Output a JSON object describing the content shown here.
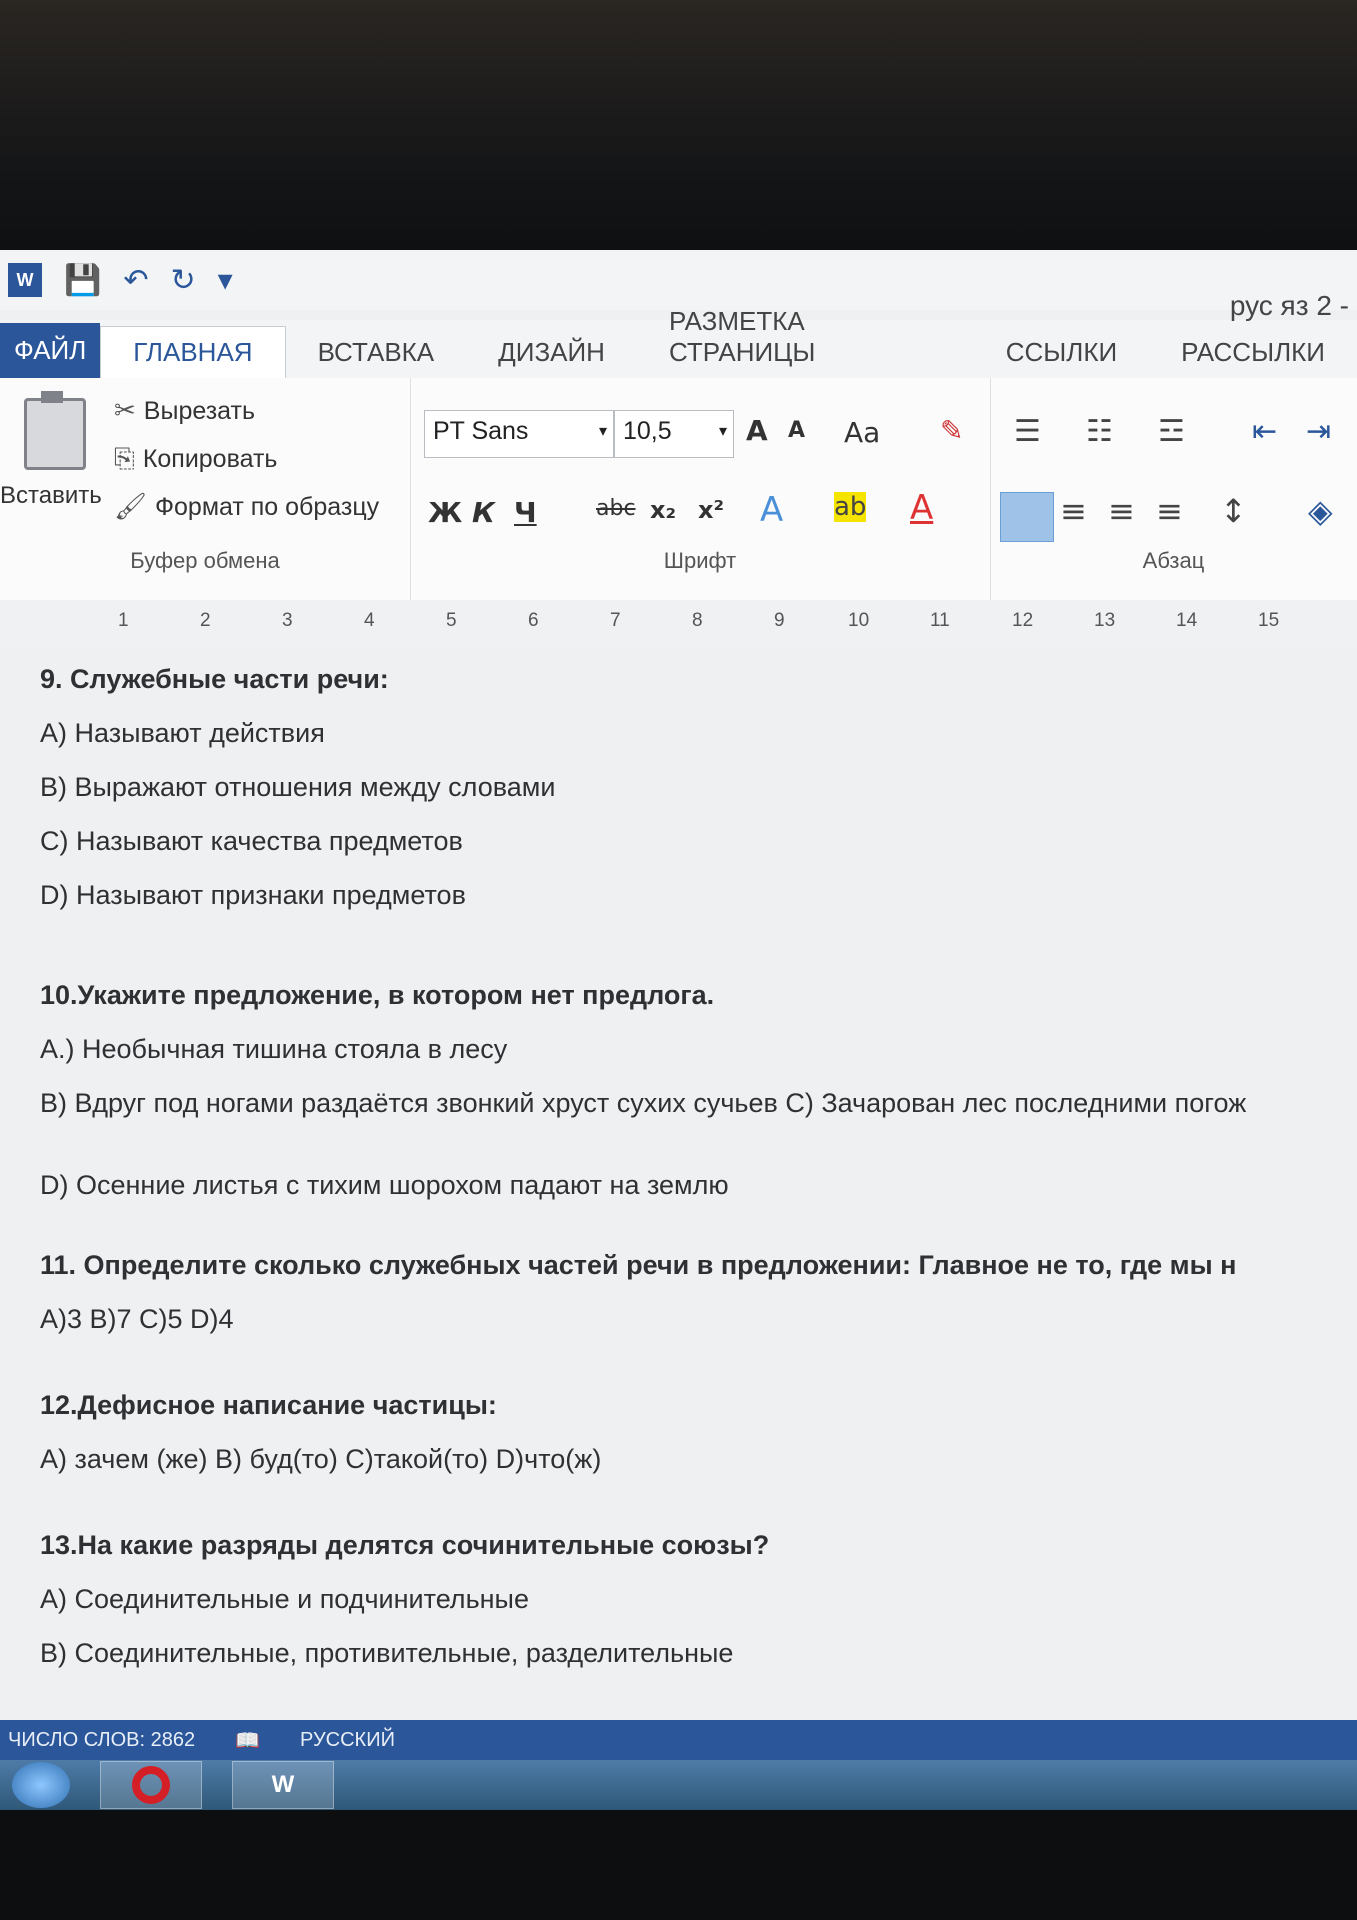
{
  "window": {
    "doc_title": "рус яз 2 -"
  },
  "tabs": [
    "ФАЙЛ",
    "ГЛАВНАЯ",
    "ВСТАВКА",
    "ДИЗАЙН",
    "РАЗМЕТКА СТРАНИЦЫ",
    "ССЫЛКИ",
    "РАССЫЛКИ"
  ],
  "clipboard": {
    "paste": "Вставить",
    "cut": "Вырезать",
    "copy": "Копировать",
    "format_painter": "Формат по образцу",
    "label": "Буфер обмена"
  },
  "font": {
    "name": "PT Sans",
    "size": "10,5",
    "grow": "A",
    "shrink": "A",
    "case": "Aa",
    "bold": "Ж",
    "italic": "К",
    "underline": "Ч",
    "strike": "abc",
    "sub": "x₂",
    "sup": "x²",
    "label": "Шрифт"
  },
  "paragraph": {
    "label": "Абзац"
  },
  "ruler": [
    "1",
    "2",
    "3",
    "4",
    "5",
    "6",
    "7",
    "8",
    "9",
    "10",
    "11",
    "12",
    "13",
    "14",
    "15"
  ],
  "document": {
    "q9": "9. Служебные части речи:",
    "q9a": "А) Называют действия",
    "q9b": "В) Выражают отношения между словами",
    "q9c": "С) Называют качества предметов",
    "q9d": "D) Называют признаки предметов",
    "q10": "10.Укажите предложение, в котором нет предлога.",
    "q10a": "А.) Необычная тишина стояла в лесу",
    "q10b": "В) Вдруг под ногами раздаётся звонкий хруст сухих сучьев С) Зачарован лес последними погож",
    "q10d": "D) Осенние листья с тихим шорохом падают на землю",
    "q11": "11. Определите сколько служебных частей речи в предложении: Главное не то, где мы н",
    "q11opts": "А)3 В)7 С)5 D)4",
    "q12": "12.Дефисное написание частицы:",
    "q12opts": "А) зачем (же) В) буд(то) С)такой(то) D)что(ж)",
    "q13": "13.На какие разряды делятся сочинительные союзы?",
    "q13a": "А) Соединительные и подчинительные",
    "q13b": "В) Соединительные, противительные, разделительные"
  },
  "status": {
    "words": "ЧИСЛО СЛОВ: 2862",
    "language": "РУССКИЙ"
  },
  "taskbar": {
    "word_button": "W"
  },
  "colors": {
    "word_blue": "#2b579a"
  }
}
